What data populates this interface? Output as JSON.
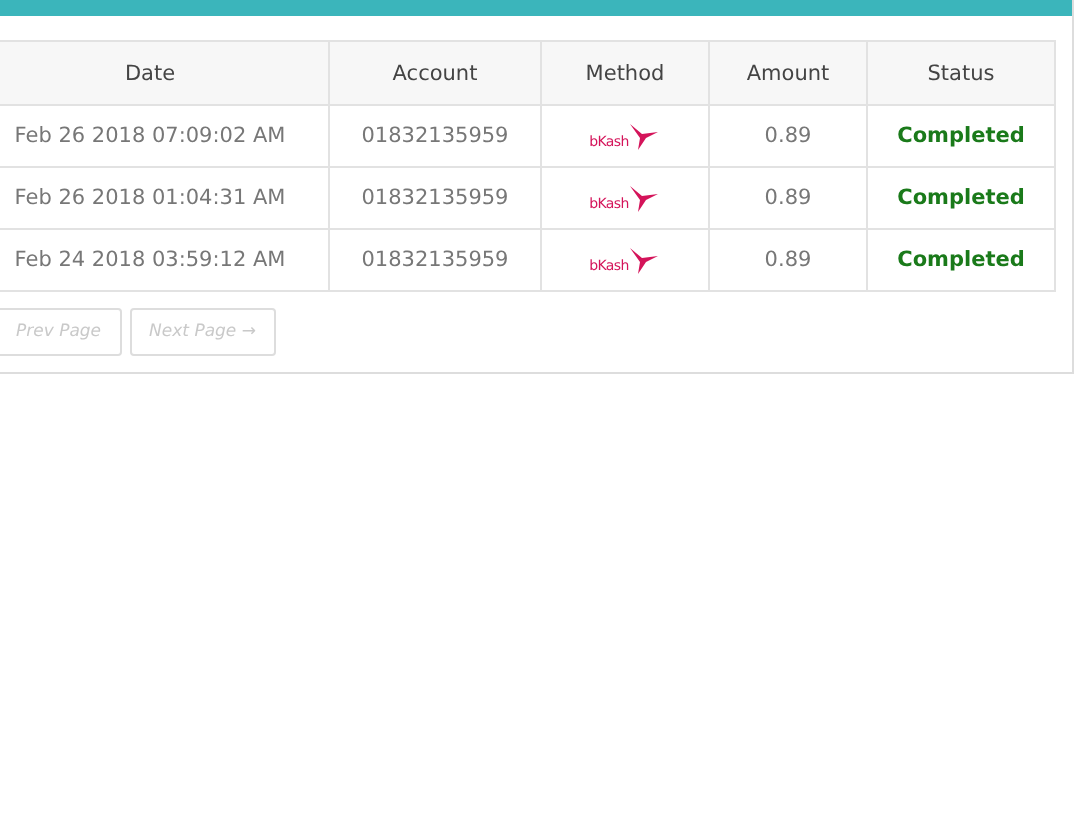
{
  "table": {
    "columns": [
      "Date",
      "Account",
      "Method",
      "Amount",
      "Status"
    ],
    "rows": [
      {
        "date": "Feb 26 2018 07:09:02 AM",
        "account": "01832135959",
        "method": "bKash",
        "amount": "0.89",
        "status": "Completed",
        "kind": "completed"
      },
      {
        "date": "Feb 26 2018 01:04:31 AM",
        "account": "01832135959",
        "method": "bKash",
        "amount": "0.89",
        "status": "Completed",
        "kind": "completed"
      },
      {
        "date": "Feb 24 2018 03:59:12 AM",
        "account": "01832135959",
        "method": "bKash",
        "amount": "0.89",
        "status": "Completed",
        "kind": "completed"
      }
    ]
  },
  "pagination": [
    {
      "label": "Prev Page",
      "disabled": true
    },
    {
      "label": "Next Page →",
      "disabled": true
    }
  ]
}
